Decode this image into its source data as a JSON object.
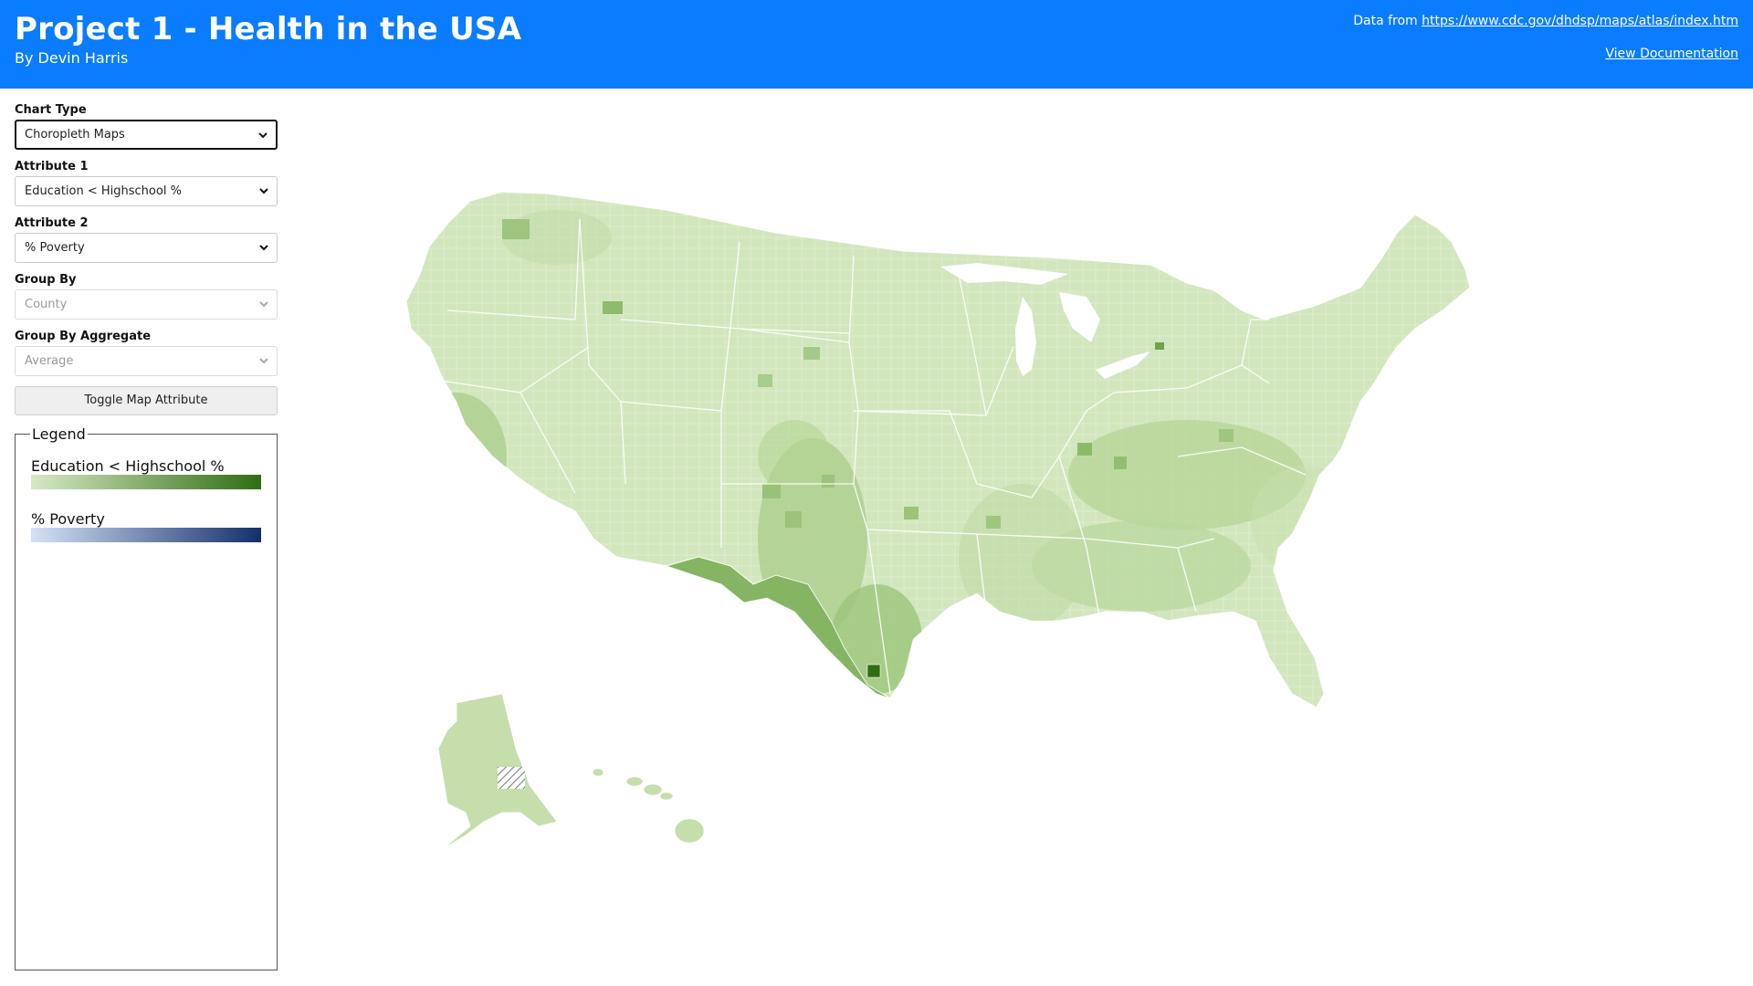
{
  "header": {
    "title": "Project 1 - Health in the USA",
    "byline": "By Devin Harris",
    "data_prefix": "Data from ",
    "data_link": "https://www.cdc.gov/dhdsp/maps/atlas/index.htm",
    "doc_link": "View Documentation",
    "bg_color": "#0a7cff"
  },
  "controls": {
    "chart_type": {
      "label": "Chart Type",
      "value": "Choropleth Maps"
    },
    "attribute1": {
      "label": "Attribute 1",
      "value": "Education < Highschool %"
    },
    "attribute2": {
      "label": "Attribute 2",
      "value": "% Poverty"
    },
    "group_by": {
      "label": "Group By",
      "value": "County",
      "disabled": true
    },
    "group_by_aggregate": {
      "label": "Group By Aggregate",
      "value": "Average",
      "disabled": true
    },
    "toggle_button": "Toggle Map Attribute"
  },
  "legend": {
    "title": "Legend",
    "items": [
      {
        "label": "Education < Highschool %",
        "color_low": "#d7e9c4",
        "color_high": "#2f6e12"
      },
      {
        "label": "% Poverty",
        "color_low": "#d4e2f5",
        "color_high": "#14306b"
      }
    ]
  },
  "map": {
    "type": "choropleth",
    "attribute": "Education < Highschool %",
    "no_data_pattern": "diagonal-hatch"
  }
}
